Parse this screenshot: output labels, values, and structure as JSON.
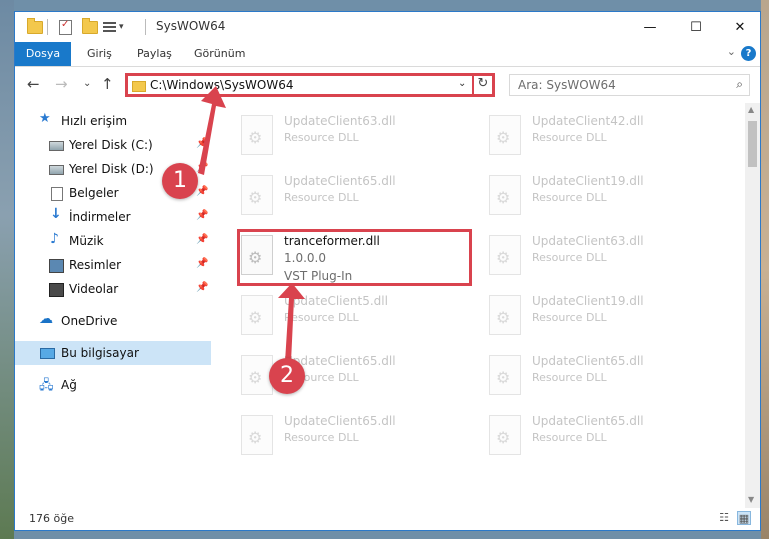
{
  "window": {
    "title": "SysWOW64",
    "controls": {
      "minimize": "—",
      "maximize": "☐",
      "close": "✕"
    }
  },
  "ribbon": {
    "tabs": [
      "Dosya",
      "Giriş",
      "Paylaş",
      "Görünüm"
    ],
    "active_tab": "Dosya",
    "help": "?",
    "expand": "⌄"
  },
  "navigation": {
    "back": "←",
    "forward": "→",
    "recent": "⌄",
    "up": "↑",
    "address": "C:\\Windows\\SysWOW64",
    "address_dropdown": "⌄",
    "refresh": "↻",
    "search_placeholder": "Ara: SysWOW64",
    "search_icon": "⌕"
  },
  "sidebar": {
    "items": [
      {
        "label": "Hızlı erişim",
        "icon": "star-icon"
      },
      {
        "label": "Yerel Disk (C:)",
        "icon": "drive-icon",
        "pinned": true
      },
      {
        "label": "Yerel Disk (D:)",
        "icon": "drive-icon",
        "pinned": true
      },
      {
        "label": "Belgeler",
        "icon": "document-icon",
        "pinned": true
      },
      {
        "label": "İndirmeler",
        "icon": "download-icon",
        "pinned": true
      },
      {
        "label": "Müzik",
        "icon": "music-icon",
        "pinned": true
      },
      {
        "label": "Resimler",
        "icon": "pictures-icon",
        "pinned": true
      },
      {
        "label": "Videolar",
        "icon": "video-icon",
        "pinned": true
      },
      {
        "label": "OneDrive",
        "icon": "cloud-icon"
      },
      {
        "label": "Bu bilgisayar",
        "icon": "computer-icon",
        "selected": true
      },
      {
        "label": "Ağ",
        "icon": "network-icon"
      }
    ],
    "pin_glyph": "📌"
  },
  "files": {
    "left": [
      {
        "name": "UpdateClient63.dll",
        "sub": "Resource DLL"
      },
      {
        "name": "UpdateClient65.dll",
        "sub": "Resource DLL"
      },
      {
        "name": "tranceformer.dll",
        "sub": "1.0.0.0",
        "sub2": "VST Plug-In"
      },
      {
        "name": "UpdateClient5.dll",
        "sub": "Resource DLL"
      },
      {
        "name": "UpdateClient65.dll",
        "sub": "Resource DLL"
      },
      {
        "name": "UpdateClient65.dll",
        "sub": "Resource DLL"
      }
    ],
    "right": [
      {
        "name": "UpdateClient42.dll",
        "sub": "Resource DLL"
      },
      {
        "name": "UpdateClient19.dll",
        "sub": "Resource DLL"
      },
      {
        "name": "UpdateClient63.dll",
        "sub": "Resource DLL"
      },
      {
        "name": "UpdateClient19.dll",
        "sub": "Resource DLL"
      },
      {
        "name": "UpdateClient65.dll",
        "sub": "Resource DLL"
      },
      {
        "name": "UpdateClient65.dll",
        "sub": "Resource DLL"
      }
    ]
  },
  "status": {
    "item_count": "176 öğe",
    "details_view": "☷",
    "tiles_view": "▦"
  },
  "annotations": {
    "step1": "1",
    "step2": "2",
    "color": "#d9434e"
  }
}
